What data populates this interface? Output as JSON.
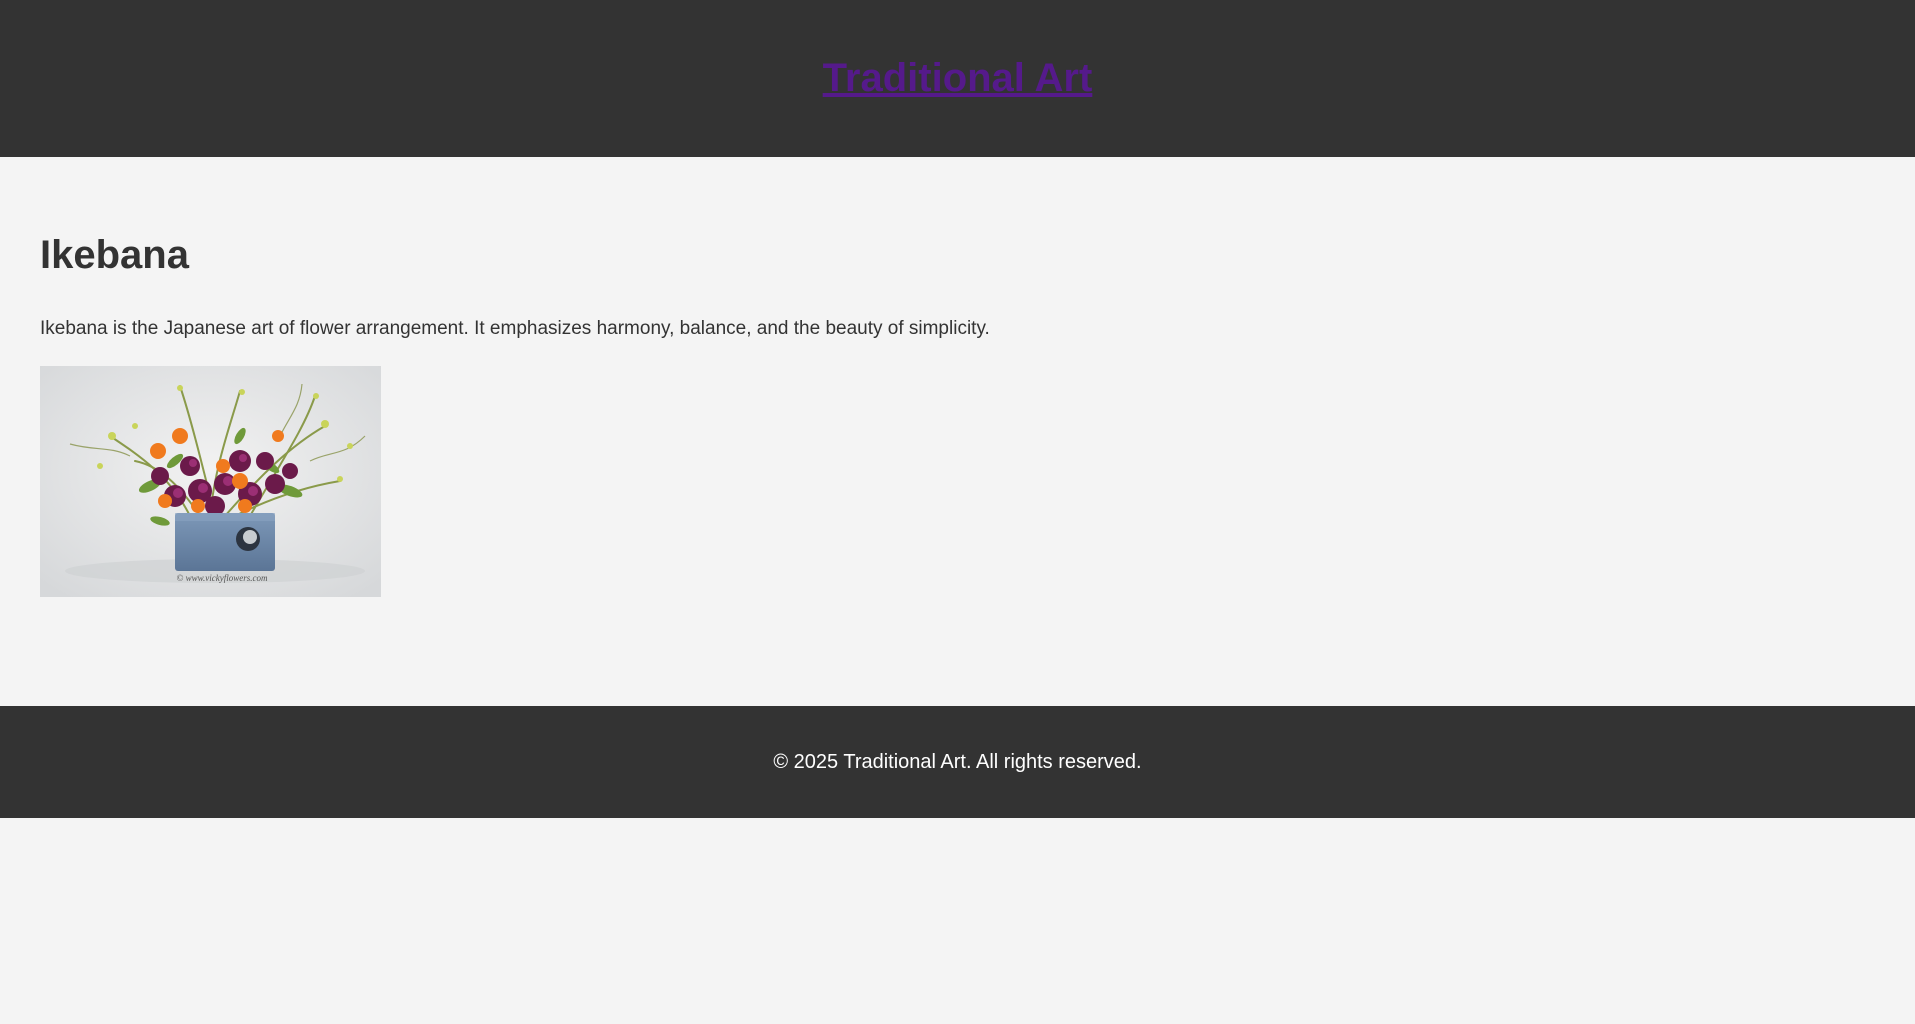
{
  "header": {
    "title": "Traditional Art",
    "title_color": "#551a8b",
    "background": "#333333"
  },
  "main": {
    "heading": "Ikebana",
    "description": "Ikebana is the Japanese art of flower arrangement. It emphasizes harmony, balance, and the beauty of simplicity.",
    "image_watermark": "© www.vickyflowers.com"
  },
  "footer": {
    "copyright": "© 2025 Traditional Art. All rights reserved."
  },
  "colors": {
    "page_background": "#f4f4f4",
    "text": "#333333",
    "footer_text": "#ffffff"
  }
}
